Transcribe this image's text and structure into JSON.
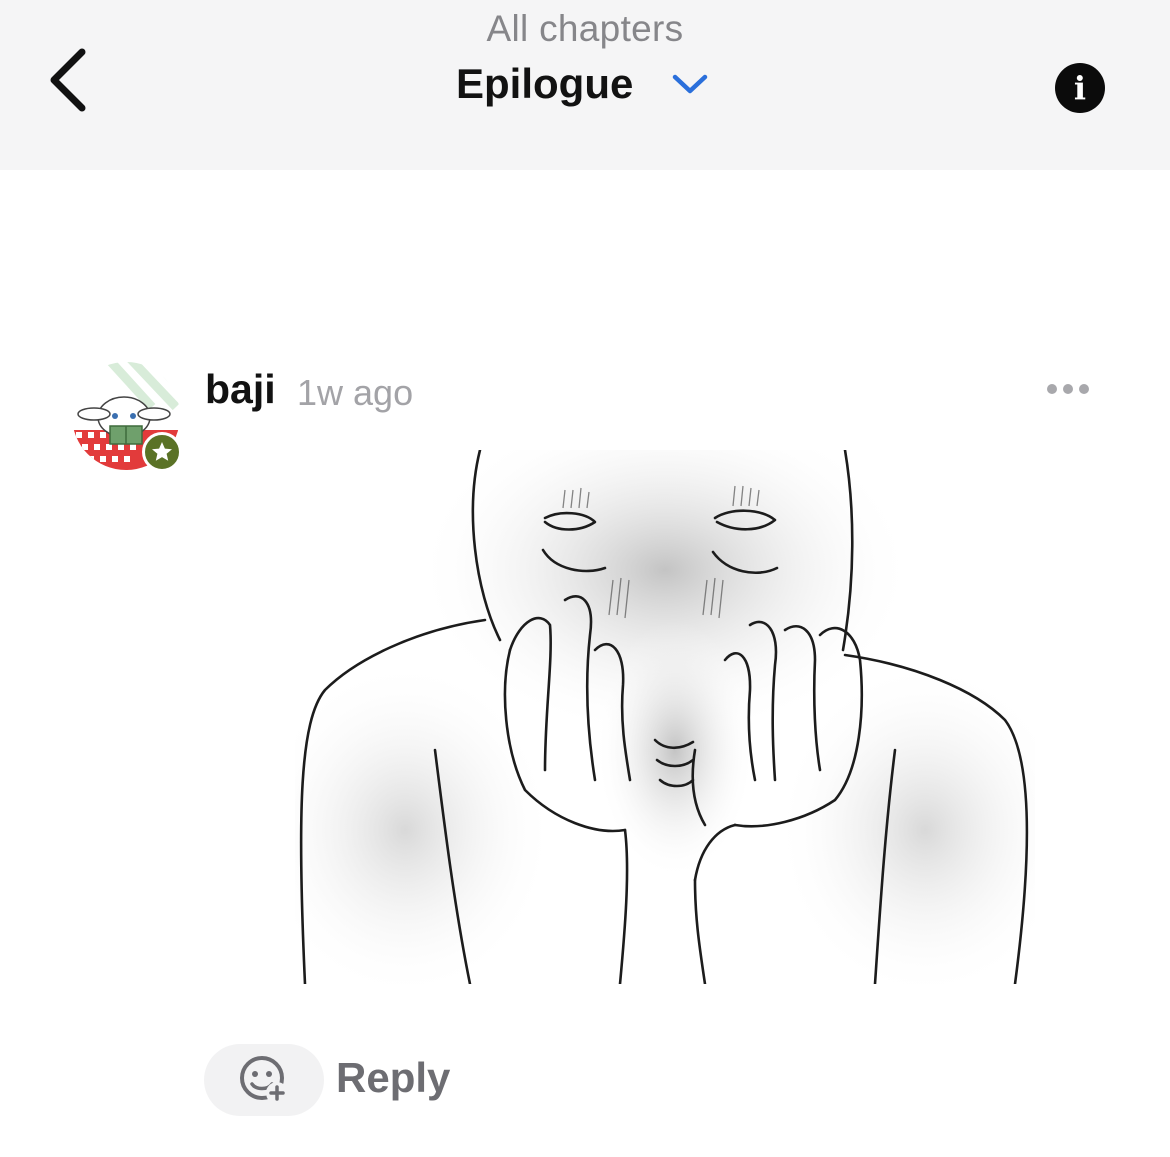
{
  "header": {
    "subtitle": "All chapters",
    "chapter_title": "Epilogue"
  },
  "comment": {
    "username": "baji",
    "timestamp": "1w ago"
  },
  "actions": {
    "reply_label": "Reply"
  },
  "icons": {
    "back": "chevron-left-icon",
    "dropdown": "chevron-down-icon",
    "info": "info-icon",
    "more": "more-horizontal-icon",
    "reaction": "add-emoji-icon",
    "badge": "star-icon"
  },
  "colors": {
    "header_bg": "#f5f5f6",
    "accent_blue": "#2a6fdb",
    "badge_green": "#5a7226",
    "muted_text": "#a3a3a7"
  }
}
